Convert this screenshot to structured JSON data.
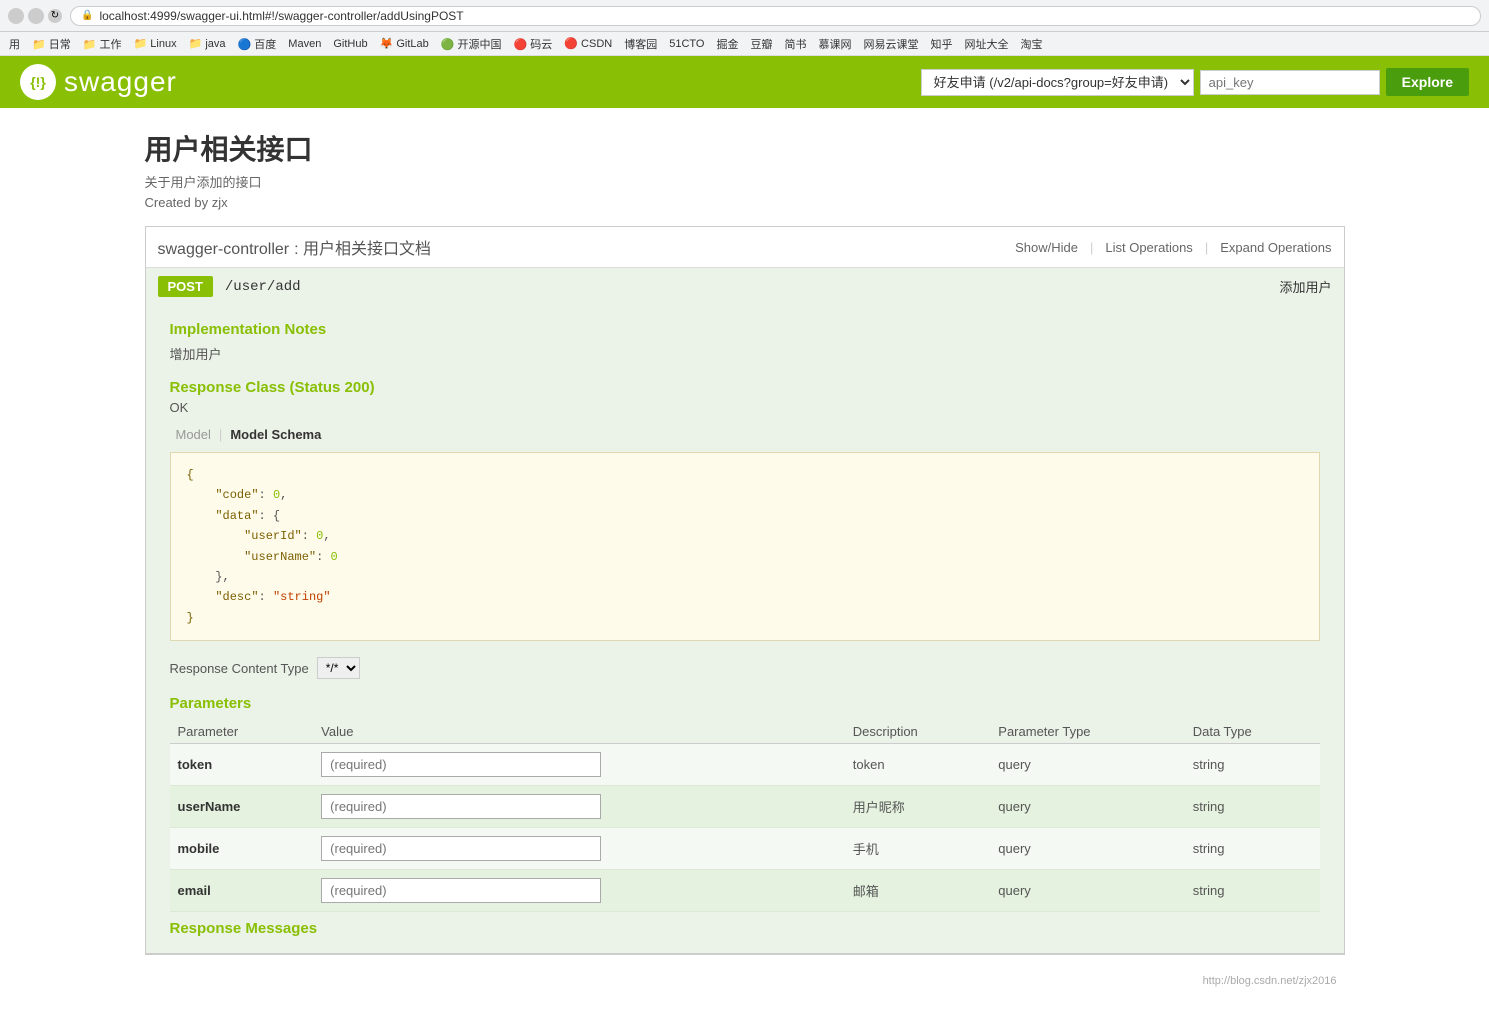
{
  "browser": {
    "url": "localhost:4999/swagger-ui.html#!/swagger-controller/addUsingPOST",
    "bookmarks": [
      {
        "label": "用",
        "color": "#e8e8e8"
      },
      {
        "label": "日常",
        "color": "#f5c518"
      },
      {
        "label": "工作",
        "color": "#ffa500"
      },
      {
        "label": "Linux",
        "color": "#f5c518"
      },
      {
        "label": "java",
        "color": "#f5c518"
      },
      {
        "label": "百度",
        "color": "#3377ff"
      },
      {
        "label": "Maven",
        "color": "#8b0000"
      },
      {
        "label": "GitHub",
        "color": "#333"
      },
      {
        "label": "GitLab",
        "color": "#e24329"
      },
      {
        "label": "开源中国",
        "color": "#3ca942"
      },
      {
        "label": "码云",
        "color": "#d03e27"
      },
      {
        "label": "CSDN",
        "color": "#c00"
      },
      {
        "label": "博客园",
        "color": "#2255a4"
      },
      {
        "label": "51CTO",
        "color": "#f60"
      },
      {
        "label": "掘金",
        "color": "#007fff"
      },
      {
        "label": "豆瓣",
        "color": "#3d8e00"
      },
      {
        "label": "简书",
        "color": "#e91e00"
      },
      {
        "label": "慕课网",
        "color": "#f5a100"
      },
      {
        "label": "网易云课堂",
        "color": "#c0392b"
      },
      {
        "label": "知乎",
        "color": "#0084ff"
      },
      {
        "label": "网址大全",
        "color": "#e8e8e8"
      },
      {
        "label": "淘宝",
        "color": "#e8e8e8"
      }
    ]
  },
  "header": {
    "logo_symbol": "{!}",
    "logo_text": "swagger",
    "api_selector_value": "好友申请 (/v2/api-docs?group=好友申请)",
    "api_key_placeholder": "api_key",
    "explore_label": "Explore"
  },
  "page": {
    "title": "用户相关接口",
    "subtitle": "关于用户添加的接口",
    "author": "Created by zjx"
  },
  "controller": {
    "name": "swagger-controller",
    "desc": "用户相关接口文档",
    "actions": {
      "show_hide": "Show/Hide",
      "list_operations": "List Operations",
      "expand_operations": "Expand Operations"
    }
  },
  "operation": {
    "method": "POST",
    "path": "/user/add",
    "summary": "添加用户",
    "impl_notes_title": "Implementation Notes",
    "impl_notes_text": "增加用户",
    "response_class_title": "Response Class (Status 200)",
    "response_ok": "OK",
    "model_label": "Model",
    "model_schema_label": "Model Schema",
    "json_content": "{\n    \"code\": 0,\n    \"data\": {\n        \"userId\": 0,\n        \"userName\": 0\n    },\n    \"desc\": \"string\"\n}",
    "response_content_type_label": "Response Content Type",
    "response_content_type_value": "*/*",
    "parameters_title": "Parameters",
    "parameters_columns": [
      "Parameter",
      "Value",
      "Description",
      "Parameter Type",
      "Data Type"
    ],
    "parameters": [
      {
        "name": "token",
        "value": "",
        "value_placeholder": "(required)",
        "description": "token",
        "param_type": "query",
        "data_type": "string"
      },
      {
        "name": "userName",
        "value": "",
        "value_placeholder": "(required)",
        "description": "用户昵称",
        "param_type": "query",
        "data_type": "string"
      },
      {
        "name": "mobile",
        "value": "",
        "value_placeholder": "(required)",
        "description": "手机",
        "param_type": "query",
        "data_type": "string"
      },
      {
        "name": "email",
        "value": "",
        "value_placeholder": "(required)",
        "description": "邮箱",
        "param_type": "query",
        "data_type": "string"
      }
    ],
    "response_messages_title": "Response Messages"
  },
  "footer": {
    "hint": "http://blog.csdn.net/zjx2016"
  },
  "colors": {
    "swagger_green": "#89bf04",
    "header_bg": "#89bf04",
    "operation_bg": "#ebf3e8",
    "json_bg": "#fffbea"
  }
}
